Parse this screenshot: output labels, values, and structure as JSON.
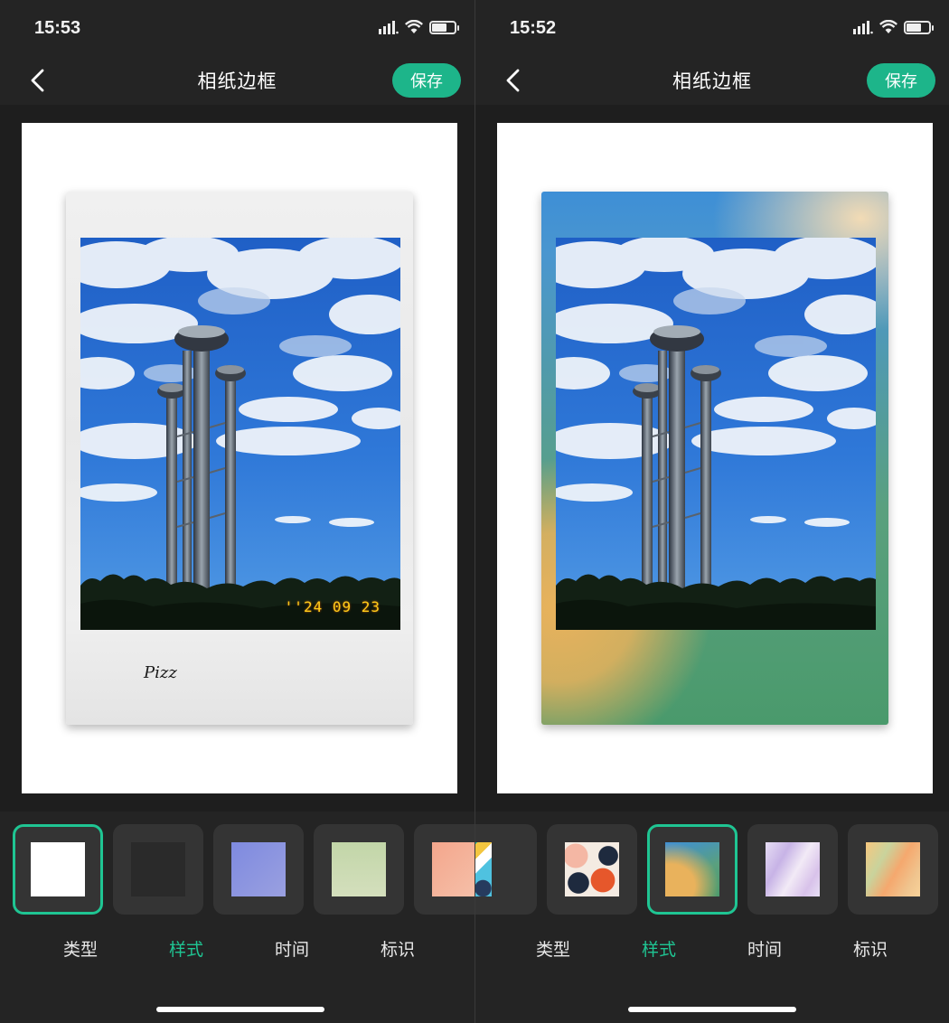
{
  "left": {
    "status": {
      "time": "15:53"
    },
    "nav": {
      "title": "相纸边框",
      "save_label": "保存"
    },
    "frame": {
      "date_stamp": "''24 09 23",
      "signature": "Pizz",
      "frame_style": "white"
    },
    "swatches": [
      {
        "name": "white",
        "color": "#ffffff",
        "selected": true
      },
      {
        "name": "dark",
        "color": "#2a2a2a",
        "selected": false
      },
      {
        "name": "periwinkle",
        "color": "#8b93dd",
        "selected": false
      },
      {
        "name": "sage",
        "color": "#c8d8ad",
        "selected": false
      },
      {
        "name": "peach",
        "color": "#f2a48e",
        "selected": false
      }
    ],
    "tabs": [
      "类型",
      "样式",
      "时间",
      "标识"
    ],
    "active_tab": "样式"
  },
  "right": {
    "status": {
      "time": "15:52"
    },
    "nav": {
      "title": "相纸边框",
      "save_label": "保存"
    },
    "frame": {
      "frame_style": "gradient-blue-yellow-green"
    },
    "swatches": [
      {
        "name": "abstract-teal-yellow",
        "selected": false
      },
      {
        "name": "abstract-pattern",
        "selected": false
      },
      {
        "name": "gradient-blue-yellow-green",
        "selected": true
      },
      {
        "name": "pastel-lilac",
        "selected": false
      },
      {
        "name": "pastel-orange",
        "selected": false
      }
    ],
    "tabs": [
      "类型",
      "样式",
      "时间",
      "标识"
    ],
    "active_tab": "样式"
  },
  "colors": {
    "accent": "#1db58a",
    "background": "#242424",
    "thumb_bg": "#343434"
  }
}
